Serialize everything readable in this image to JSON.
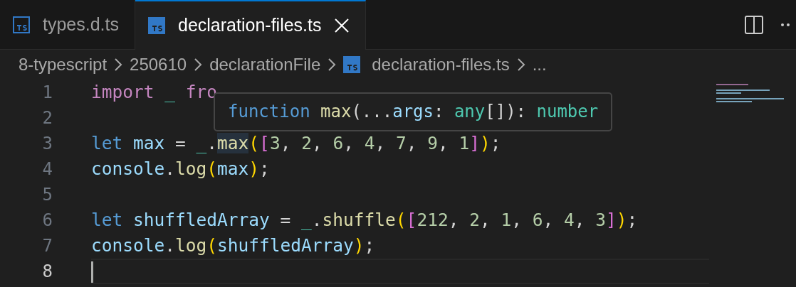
{
  "tabs": [
    {
      "label": "types.d.ts",
      "selected": false
    },
    {
      "label": "declaration-files.ts",
      "selected": true
    }
  ],
  "breadcrumb": [
    {
      "label": "8-typescript",
      "kind": "folder"
    },
    {
      "label": "250610",
      "kind": "folder"
    },
    {
      "label": "declarationFile",
      "kind": "folder"
    },
    {
      "label": "declaration-files.ts",
      "kind": "file"
    },
    {
      "label": "...",
      "kind": "more"
    }
  ],
  "editor": {
    "lines": [
      {
        "number": "1",
        "current": false,
        "tokens": [
          {
            "text": "import ",
            "kind": "keyword"
          },
          {
            "text": "_ ",
            "kind": "type"
          },
          {
            "text": "fro",
            "kind": "keyword"
          }
        ]
      },
      {
        "number": "2",
        "current": false
      },
      {
        "number": "3",
        "current": false,
        "tokens": [
          {
            "text": "let ",
            "kind": "storage"
          },
          {
            "text": "max",
            "kind": "variable"
          },
          {
            "text": " = ",
            "kind": "punct"
          },
          {
            "text": "_",
            "kind": "type"
          },
          {
            "text": ".",
            "kind": "punct"
          },
          {
            "text": "max",
            "kind": "function",
            "highlight": true
          },
          {
            "text": "(",
            "kind": "bracket1"
          },
          {
            "text": "[",
            "kind": "bracket2"
          },
          {
            "text": "3",
            "kind": "number"
          },
          {
            "text": ", ",
            "kind": "punct"
          },
          {
            "text": "2",
            "kind": "number"
          },
          {
            "text": ", ",
            "kind": "punct"
          },
          {
            "text": "6",
            "kind": "number"
          },
          {
            "text": ", ",
            "kind": "punct"
          },
          {
            "text": "4",
            "kind": "number"
          },
          {
            "text": ", ",
            "kind": "punct"
          },
          {
            "text": "7",
            "kind": "number"
          },
          {
            "text": ", ",
            "kind": "punct"
          },
          {
            "text": "9",
            "kind": "number"
          },
          {
            "text": ", ",
            "kind": "punct"
          },
          {
            "text": "1",
            "kind": "number"
          },
          {
            "text": "]",
            "kind": "bracket2"
          },
          {
            "text": ")",
            "kind": "bracket1"
          },
          {
            "text": ";",
            "kind": "punct"
          }
        ]
      },
      {
        "number": "4",
        "current": false,
        "tokens": [
          {
            "text": "console",
            "kind": "variable"
          },
          {
            "text": ".",
            "kind": "punct"
          },
          {
            "text": "log",
            "kind": "function"
          },
          {
            "text": "(",
            "kind": "bracket1"
          },
          {
            "text": "max",
            "kind": "variable"
          },
          {
            "text": ")",
            "kind": "bracket1"
          },
          {
            "text": ";",
            "kind": "punct"
          }
        ]
      },
      {
        "number": "5",
        "current": false
      },
      {
        "number": "6",
        "current": false,
        "tokens": [
          {
            "text": "let ",
            "kind": "storage"
          },
          {
            "text": "shuffledArray",
            "kind": "variable"
          },
          {
            "text": " = ",
            "kind": "punct"
          },
          {
            "text": "_",
            "kind": "type"
          },
          {
            "text": ".",
            "kind": "punct"
          },
          {
            "text": "shuffle",
            "kind": "function"
          },
          {
            "text": "(",
            "kind": "bracket1"
          },
          {
            "text": "[",
            "kind": "bracket2"
          },
          {
            "text": "212",
            "kind": "number"
          },
          {
            "text": ", ",
            "kind": "punct"
          },
          {
            "text": "2",
            "kind": "number"
          },
          {
            "text": ", ",
            "kind": "punct"
          },
          {
            "text": "1",
            "kind": "number"
          },
          {
            "text": ", ",
            "kind": "punct"
          },
          {
            "text": "6",
            "kind": "number"
          },
          {
            "text": ", ",
            "kind": "punct"
          },
          {
            "text": "4",
            "kind": "number"
          },
          {
            "text": ", ",
            "kind": "punct"
          },
          {
            "text": "3",
            "kind": "number"
          },
          {
            "text": "]",
            "kind": "bracket2"
          },
          {
            "text": ")",
            "kind": "bracket1"
          },
          {
            "text": ";",
            "kind": "punct"
          }
        ]
      },
      {
        "number": "7",
        "current": false,
        "tokens": [
          {
            "text": "console",
            "kind": "variable"
          },
          {
            "text": ".",
            "kind": "punct"
          },
          {
            "text": "log",
            "kind": "function"
          },
          {
            "text": "(",
            "kind": "bracket1"
          },
          {
            "text": "shuffledArray",
            "kind": "variable"
          },
          {
            "text": ")",
            "kind": "bracket1"
          },
          {
            "text": ";",
            "kind": "punct"
          }
        ]
      },
      {
        "number": "8",
        "current": true
      }
    ],
    "hover": {
      "tokens": [
        {
          "text": "function ",
          "kind": "storage"
        },
        {
          "text": "max",
          "kind": "function"
        },
        {
          "text": "(...",
          "kind": "punct"
        },
        {
          "text": "args",
          "kind": "variable"
        },
        {
          "text": ": ",
          "kind": "punct"
        },
        {
          "text": "any",
          "kind": "type"
        },
        {
          "text": "[]): ",
          "kind": "punct"
        },
        {
          "text": "number",
          "kind": "type"
        }
      ]
    }
  }
}
